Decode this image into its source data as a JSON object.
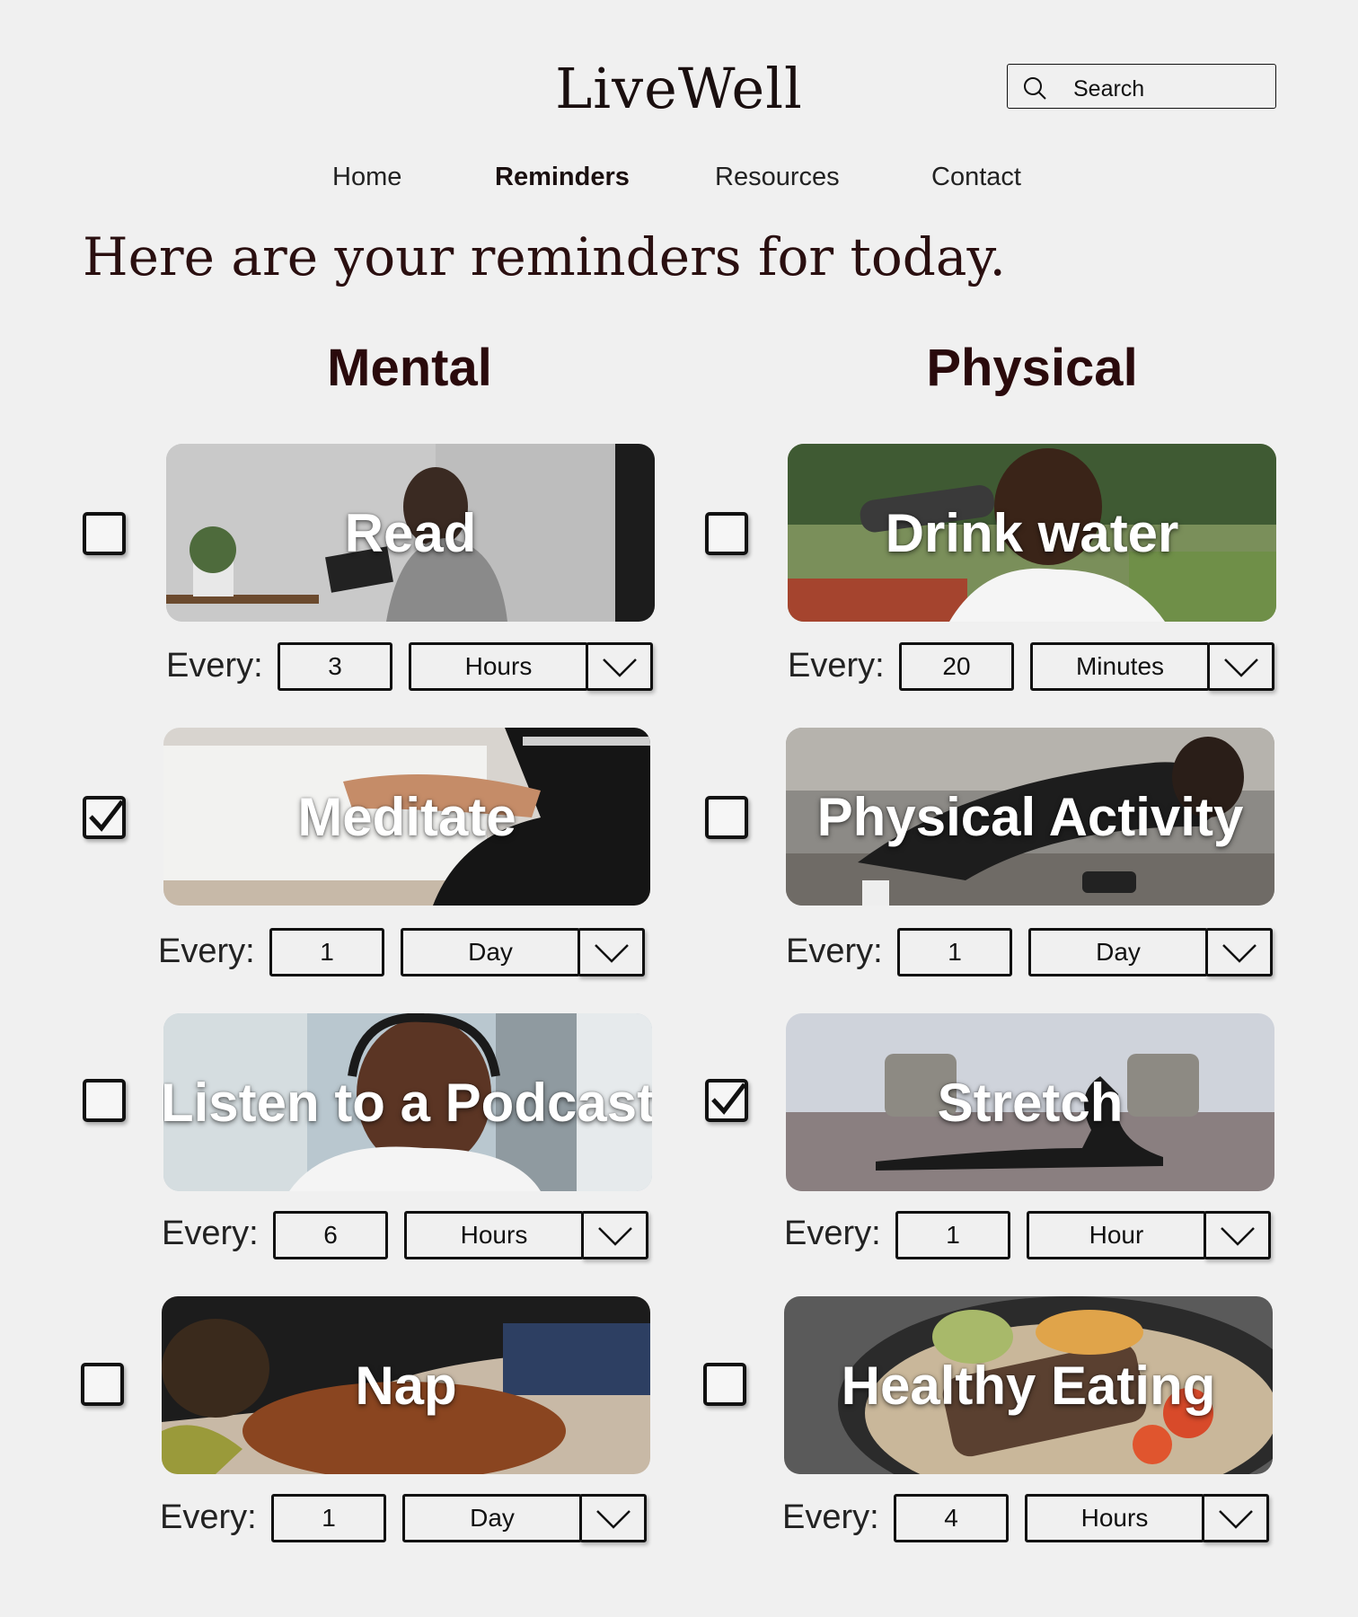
{
  "header": {
    "logo": "LiveWell",
    "search_placeholder": "Search",
    "nav": [
      "Home",
      "Reminders",
      "Resources",
      "Contact"
    ],
    "active_nav": "Reminders"
  },
  "headline": "Here are your reminders for today.",
  "columns": {
    "mental": {
      "title": "Mental",
      "items": [
        {
          "title": "Read",
          "checked": false,
          "every_label": "Every:",
          "amount": "3",
          "unit": "Hours"
        },
        {
          "title": "Meditate",
          "checked": true,
          "every_label": "Every:",
          "amount": "1",
          "unit": "Day"
        },
        {
          "title": "Listen to a Podcast",
          "checked": false,
          "every_label": "Every:",
          "amount": "6",
          "unit": "Hours"
        },
        {
          "title": "Nap",
          "checked": false,
          "every_label": "Every:",
          "amount": "1",
          "unit": "Day"
        }
      ]
    },
    "physical": {
      "title": "Physical",
      "items": [
        {
          "title": "Drink water",
          "checked": false,
          "every_label": "Every:",
          "amount": "20",
          "unit": "Minutes"
        },
        {
          "title": "Physical Activity",
          "checked": false,
          "every_label": "Every:",
          "amount": "1",
          "unit": "Day"
        },
        {
          "title": "Stretch",
          "checked": true,
          "every_label": "Every:",
          "amount": "1",
          "unit": "Hour"
        },
        {
          "title": "Healthy Eating",
          "checked": false,
          "every_label": "Every:",
          "amount": "4",
          "unit": "Hours"
        }
      ]
    }
  },
  "icons": {
    "search": "search-icon",
    "checkmark": "checkmark-icon",
    "dropdown": "chevron-down-icon"
  }
}
